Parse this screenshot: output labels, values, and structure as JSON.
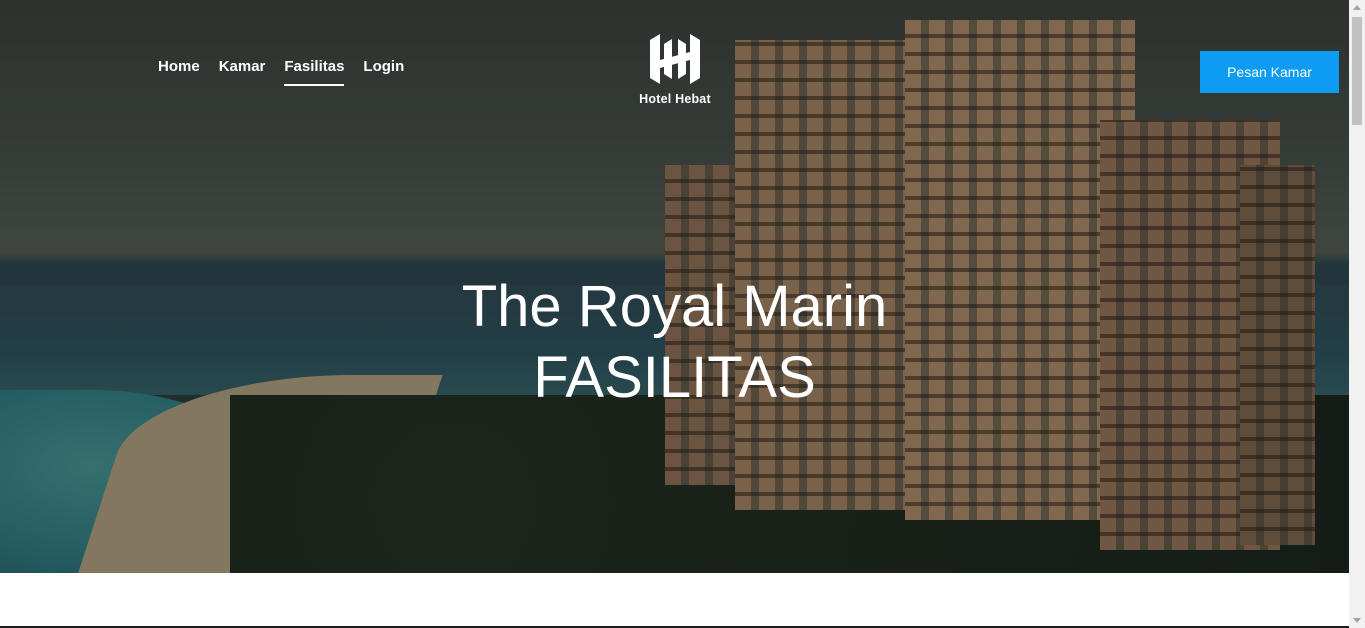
{
  "nav": {
    "items": [
      {
        "label": "Home",
        "active": false
      },
      {
        "label": "Kamar",
        "active": false
      },
      {
        "label": "Fasilitas",
        "active": true
      },
      {
        "label": "Login",
        "active": false
      }
    ]
  },
  "brand": {
    "name": "Hotel Hebat",
    "icon": "hotel-hebat-logo-icon"
  },
  "cta": {
    "label": "Pesan Kamar",
    "color": "#0d9cf2"
  },
  "hero": {
    "title_line1": "The Royal Marin",
    "title_line2": "FASILITAS"
  }
}
